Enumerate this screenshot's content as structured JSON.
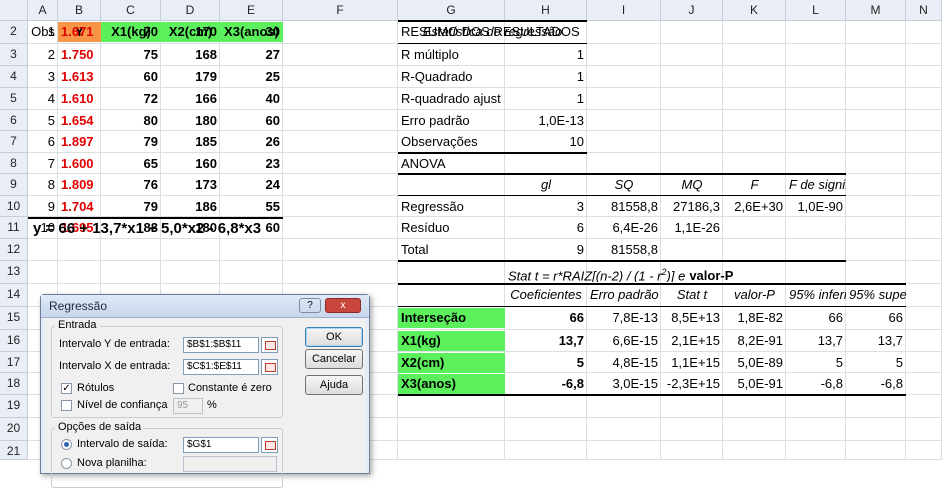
{
  "columns": [
    "A",
    "B",
    "C",
    "D",
    "E",
    "F",
    "G",
    "H",
    "I",
    "J",
    "K",
    "L",
    "M",
    "N"
  ],
  "rows": [
    "1",
    "2",
    "3",
    "4",
    "5",
    "6",
    "7",
    "8",
    "9",
    "10",
    "11",
    "12",
    "13",
    "14",
    "15",
    "16",
    "17",
    "18",
    "19",
    "20",
    "21"
  ],
  "table": {
    "headers": [
      "Obs",
      "Y",
      "X1(kg)",
      "X2(cm)",
      "X3(anos)"
    ],
    "rows": [
      [
        "1",
        "1.671",
        "70",
        "170",
        "30"
      ],
      [
        "2",
        "1.750",
        "75",
        "168",
        "27"
      ],
      [
        "3",
        "1.613",
        "60",
        "179",
        "25"
      ],
      [
        "4",
        "1.610",
        "72",
        "166",
        "40"
      ],
      [
        "5",
        "1.654",
        "80",
        "180",
        "60"
      ],
      [
        "6",
        "1.897",
        "79",
        "185",
        "26"
      ],
      [
        "7",
        "1.600",
        "65",
        "160",
        "23"
      ],
      [
        "8",
        "1.809",
        "76",
        "173",
        "24"
      ],
      [
        "9",
        "1.704",
        "79",
        "186",
        "55"
      ],
      [
        "10",
        "1.695",
        "83",
        "180",
        "60"
      ]
    ],
    "colors": {
      "y_header": "#f79646",
      "x_header": "#5cf05c",
      "y_values": "#e00000"
    }
  },
  "equation": "y = 66 + 13,7*x1 + 5,0*x2 - 6,8*x3",
  "summary": {
    "title": "RESUMO DOS RESULTADOS",
    "reg_stats_title": "Estatística de regressão",
    "reg_stats": [
      {
        "label": "R múltiplo",
        "value": "1"
      },
      {
        "label": "R-Quadrado",
        "value": "1"
      },
      {
        "label": "R-quadrado ajust",
        "value": "1"
      },
      {
        "label": "Erro padrão",
        "value": "1,0E-13"
      },
      {
        "label": "Observações",
        "value": "10"
      }
    ],
    "anova_title": "ANOVA",
    "anova_headers": [
      "gl",
      "SQ",
      "MQ",
      "F",
      "F de significação"
    ],
    "anova_rows": [
      {
        "label": "Regressão",
        "values": [
          "3",
          "81558,8",
          "27186,3",
          "2,6E+30",
          "1,0E-90"
        ]
      },
      {
        "label": "Resíduo",
        "values": [
          "6",
          "6,4E-26",
          "1,1E-26",
          "",
          ""
        ]
      },
      {
        "label": "Total",
        "values": [
          "9",
          "81558,8",
          "",
          "",
          ""
        ]
      }
    ],
    "stat_note_a": "Stat t = r*RAIZ[(n-2) / (1 - r",
    "stat_note_sup": "2",
    "stat_note_b": ")] e",
    "stat_note_c": "valor-P",
    "coef_headers": [
      "Coeficientes",
      "Erro padrão",
      "Stat t",
      "valor-P",
      "95% inferiores",
      "95% superiores"
    ],
    "coef_rows": [
      {
        "label": "Interseção",
        "values": [
          "66",
          "7,8E-13",
          "8,5E+13",
          "1,8E-82",
          "66",
          "66"
        ]
      },
      {
        "label": "X1(kg)",
        "values": [
          "13,7",
          "6,6E-15",
          "2,1E+15",
          "8,2E-91",
          "13,7",
          "13,7"
        ]
      },
      {
        "label": "X2(cm)",
        "values": [
          "5",
          "4,8E-15",
          "1,1E+15",
          "5,0E-89",
          "5",
          "5"
        ]
      },
      {
        "label": "X3(anos)",
        "values": [
          "-6,8",
          "3,0E-15",
          "-2,3E+15",
          "5,0E-91",
          "-6,8",
          "-6,8"
        ]
      }
    ],
    "coef_label_color": "#5cf05c"
  },
  "dialog": {
    "title": "Regressão",
    "help_icon": "?",
    "close_icon": "x",
    "entrada_label": "Entrada",
    "y_label": "Intervalo Y de entrada:",
    "y_value": "$B$1:$B$11",
    "x_label": "Intervalo X de entrada:",
    "x_value": "$C$1:$E$11",
    "rotulos_label": "Rótulos",
    "rotulos_checked": true,
    "constante_label": "Constante é zero",
    "nivel_label": "Nível de confiança",
    "nivel_value": "95",
    "pct": "%",
    "ok": "OK",
    "cancel": "Cancelar",
    "help": "Ajuda",
    "saida_label": "Opções de saída",
    "intervalo_saida_label": "Intervalo de saída:",
    "intervalo_saida_value": "$G$1",
    "nova_label": "Nova planilha:"
  }
}
